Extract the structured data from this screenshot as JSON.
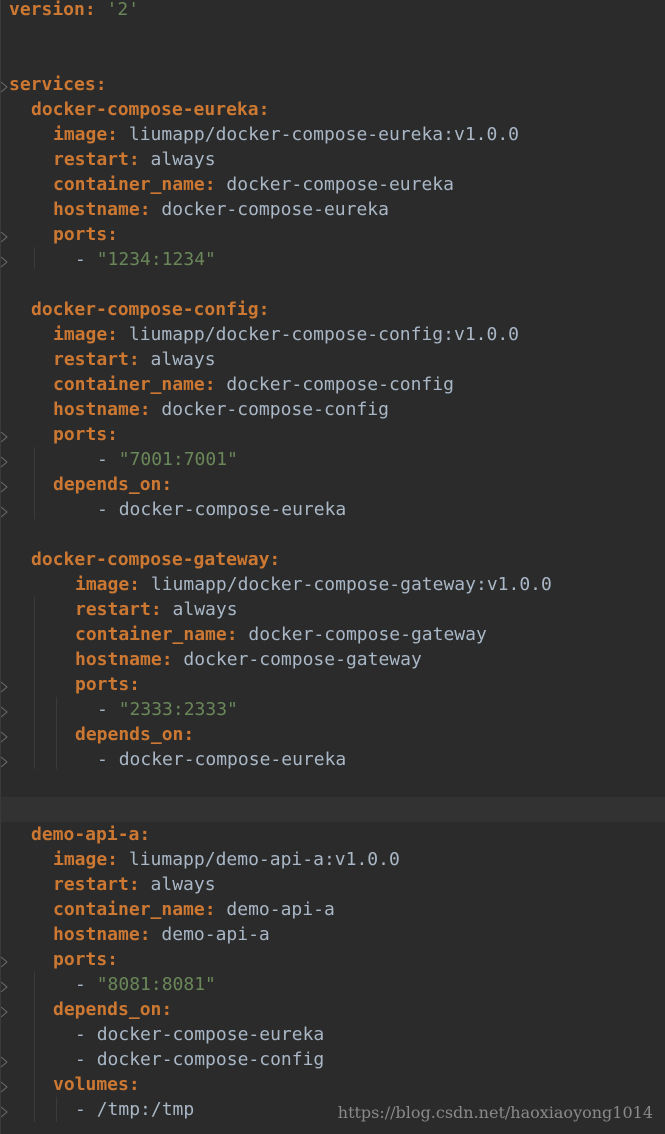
{
  "yaml": {
    "version_key": "version:",
    "version_val": "'2'",
    "services_key": "services:",
    "eureka": {
      "name": "docker-compose-eureka:",
      "image_key": "image:",
      "image_val": "liumapp/docker-compose-eureka:v1.0.0",
      "restart_key": "restart:",
      "restart_val": "always",
      "container_key": "container_name:",
      "container_val": "docker-compose-eureka",
      "hostname_key": "hostname:",
      "hostname_val": "docker-compose-eureka",
      "ports_key": "ports:",
      "port_val": "\"1234:1234\""
    },
    "config": {
      "name": "docker-compose-config:",
      "image_key": "image:",
      "image_val": "liumapp/docker-compose-config:v1.0.0",
      "restart_key": "restart:",
      "restart_val": "always",
      "container_key": "container_name:",
      "container_val": "docker-compose-config",
      "hostname_key": "hostname:",
      "hostname_val": "docker-compose-config",
      "ports_key": "ports:",
      "port_val": "\"7001:7001\"",
      "depends_key": "depends_on:",
      "depends_val": "docker-compose-eureka"
    },
    "gateway": {
      "name": "docker-compose-gateway:",
      "image_key": "image:",
      "image_val": "liumapp/docker-compose-gateway:v1.0.0",
      "restart_key": "restart:",
      "restart_val": "always",
      "container_key": "container_name:",
      "container_val": "docker-compose-gateway",
      "hostname_key": "hostname:",
      "hostname_val": "docker-compose-gateway",
      "ports_key": "ports:",
      "port_val": "\"2333:2333\"",
      "depends_key": "depends_on:",
      "depends_val": "docker-compose-eureka"
    },
    "demo": {
      "name": "demo-api-a:",
      "image_key": "image:",
      "image_val": "liumapp/demo-api-a:v1.0.0",
      "restart_key": "restart:",
      "restart_val": "always",
      "container_key": "container_name:",
      "container_val": "demo-api-a",
      "hostname_key": "hostname:",
      "hostname_val": "demo-api-a",
      "ports_key": "ports:",
      "port_val": "\"8081:8081\"",
      "depends_key": "depends_on:",
      "depends_val_1": "docker-compose-eureka",
      "depends_val_2": "docker-compose-config",
      "volumes_key": "volumes:",
      "volumes_val": "/tmp:/tmp"
    },
    "dash": "- "
  },
  "watermark": "https://blog.csdn.net/haoxiaoyong1014",
  "colors": {
    "background": "#2b2b2b",
    "key": "#cc7832",
    "value": "#a9b7c6",
    "string": "#6a8759"
  }
}
